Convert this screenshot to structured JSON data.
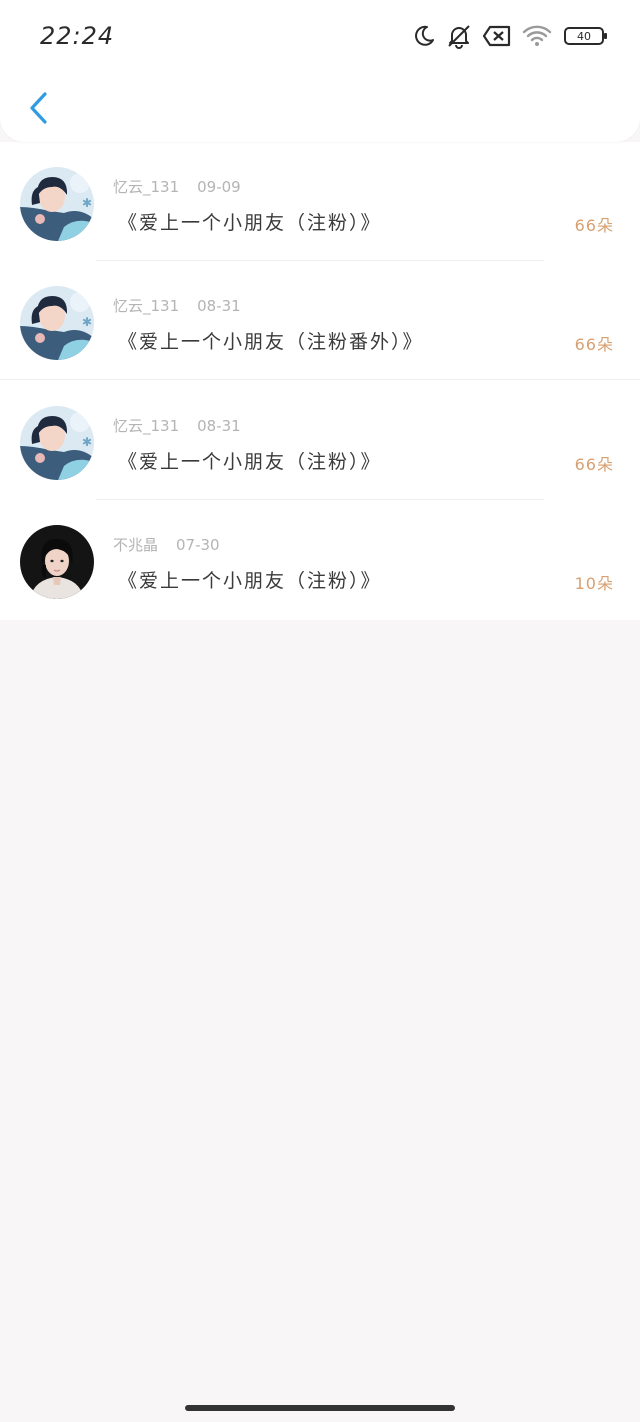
{
  "status_bar": {
    "time": "22:24",
    "battery": "40"
  },
  "nav": {
    "back_icon": "chevron-left-icon"
  },
  "colors": {
    "accent_blue": "#2f9be3",
    "count_orange": "#d7a071",
    "meta_gray": "#b4b4b4",
    "background": "#f8f6f7"
  },
  "items": [
    {
      "username": "忆云_131",
      "date": "09-09",
      "title": "《爱上一个小朋友（注粉）》",
      "count": "66朵",
      "avatar": "boy-illustration"
    },
    {
      "username": "忆云_131",
      "date": "08-31",
      "title": "《爱上一个小朋友（注粉番外）》",
      "count": "66朵",
      "avatar": "boy-illustration"
    },
    {
      "username": "忆云_131",
      "date": "08-31",
      "title": "《爱上一个小朋友（注粉）》",
      "count": "66朵",
      "avatar": "boy-illustration"
    },
    {
      "username": "不兆晶",
      "date": "07-30",
      "title": "《爱上一个小朋友（注粉）》",
      "count": "10朵",
      "avatar": "girl-photo"
    }
  ]
}
